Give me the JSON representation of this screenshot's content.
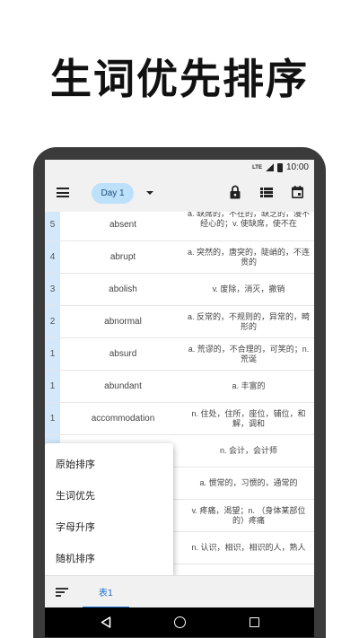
{
  "promo": {
    "title": "生词优先排序"
  },
  "status_bar": {
    "network": "LTE",
    "time": "10:00"
  },
  "app_bar": {
    "day_chip": "Day 1"
  },
  "words": [
    {
      "count": "5",
      "word": "absent",
      "meaning": "a. 缺席的，不在的，缺乏的，漫不经心的；v. 使缺席，使不在"
    },
    {
      "count": "4",
      "word": "abrupt",
      "meaning": "a. 突然的，唐突的，陡峭的，不连贯的"
    },
    {
      "count": "3",
      "word": "abolish",
      "meaning": "v. 废除，消灭，撤销"
    },
    {
      "count": "2",
      "word": "abnormal",
      "meaning": "a. 反常的，不规则的，异常的，畸形的"
    },
    {
      "count": "1",
      "word": "absurd",
      "meaning": "a. 荒谬的，不合理的，可笑的；n. 荒诞"
    },
    {
      "count": "1",
      "word": "abundant",
      "meaning": "a. 丰富的"
    },
    {
      "count": "1",
      "word": "accommodation",
      "meaning": "n. 住处，住所，座位，铺位，和解，调和"
    },
    {
      "count": "",
      "word": "",
      "meaning": "n. 会计，会计师"
    },
    {
      "count": "",
      "word": "",
      "meaning": "a. 惯常的，习惯的，通常的"
    },
    {
      "count": "",
      "word": "",
      "meaning": "v. 疼痛，渴望；n. （身体某部位的）疼痛"
    },
    {
      "count": "",
      "word": "",
      "meaning": "n. 认识，相识，相识的人，熟人"
    },
    {
      "count": "",
      "word": "",
      "meaning": ""
    }
  ],
  "sort_menu": {
    "items": [
      "原始排序",
      "生词优先",
      "字母升序",
      "随机排序"
    ]
  },
  "tab_bar": {
    "tab_label": "表1"
  },
  "colors": {
    "accent": "#1976d2",
    "chip": "#bde0fb",
    "count_column": "#d3e9fb"
  }
}
